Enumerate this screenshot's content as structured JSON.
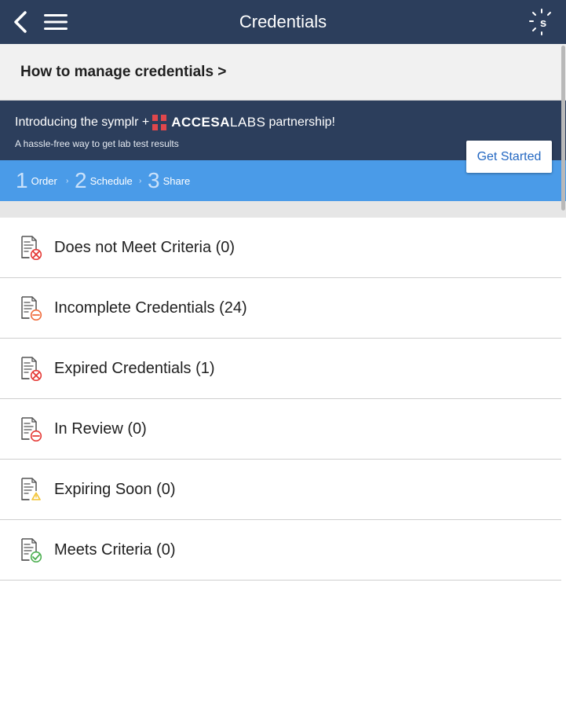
{
  "header": {
    "title": "Credentials"
  },
  "help_link": {
    "label": "How to manage credentials >"
  },
  "banner": {
    "intro": "Introducing the symplr +",
    "brand_bold": "ACCESA",
    "brand_light": "LABS",
    "partnership": "partnership!",
    "subtitle": "A hassle-free way to get lab test results",
    "cta_label": "Get Started",
    "brand_color": "#e0474c",
    "steps": [
      {
        "num": "1",
        "label": "Order"
      },
      {
        "num": "2",
        "label": "Schedule"
      },
      {
        "num": "3",
        "label": "Share"
      }
    ]
  },
  "categories": [
    {
      "label": "Does not Meet Criteria (0)",
      "icon": "doc-x-icon",
      "badge_color": "#e53935"
    },
    {
      "label": "Incomplete Credentials (24)",
      "icon": "doc-minus-icon",
      "badge_color": "#f06a3a"
    },
    {
      "label": "Expired Credentials (1)",
      "icon": "doc-x-icon",
      "badge_color": "#e53935"
    },
    {
      "label": "In Review (0)",
      "icon": "doc-minus-icon",
      "badge_color": "#e53935"
    },
    {
      "label": "Expiring Soon (0)",
      "icon": "doc-warning-icon",
      "badge_color": "#f2c230"
    },
    {
      "label": "Meets Criteria (0)",
      "icon": "doc-check-icon",
      "badge_color": "#4caf50"
    }
  ]
}
